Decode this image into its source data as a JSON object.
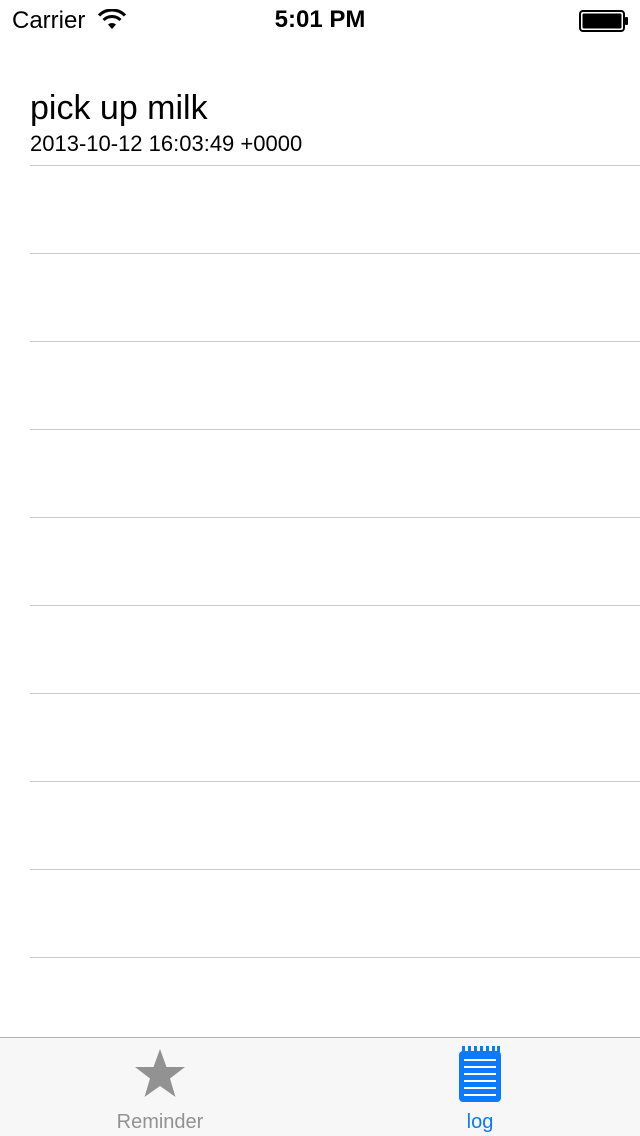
{
  "status_bar": {
    "carrier": "Carrier",
    "time": "5:01 PM",
    "wifi_icon": "wifi-icon",
    "battery_icon": "battery-icon"
  },
  "log": {
    "entries": [
      {
        "title": "pick up milk",
        "timestamp": "2013-10-12 16:03:49 +0000"
      }
    ],
    "empty_rows": 9
  },
  "tab_bar": {
    "tabs": [
      {
        "label": "Reminder",
        "icon": "star-icon",
        "selected": false
      },
      {
        "label": "log",
        "icon": "notepad-icon",
        "selected": true
      }
    ]
  },
  "colors": {
    "accent": "#0a7aff",
    "inactive": "#929292",
    "separator": "#c8c7cc",
    "tab_bar_bg": "#f7f7f7"
  }
}
